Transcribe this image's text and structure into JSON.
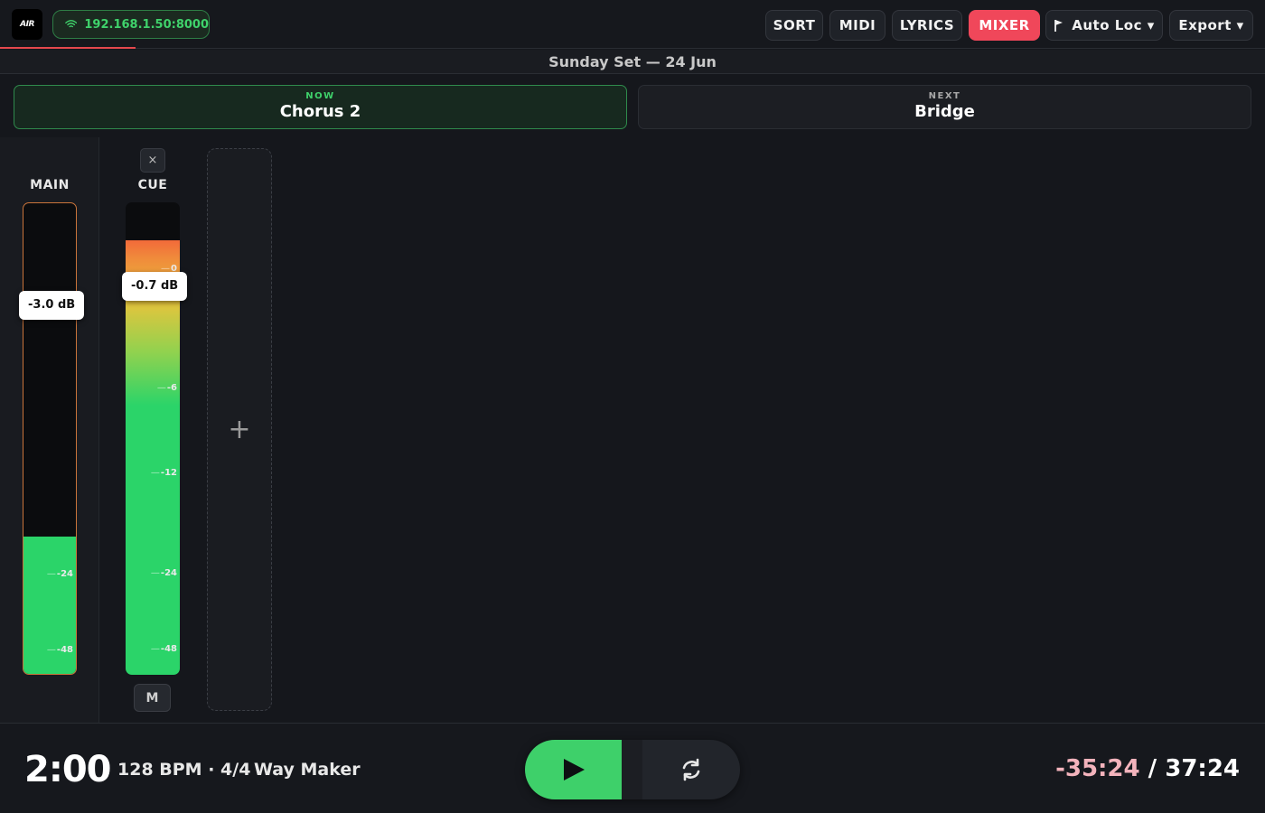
{
  "app": {
    "logo_text": "AIR",
    "connection_address": "192.168.1.50:8000",
    "connection_icon": "wifi-icon"
  },
  "toolbar": {
    "sort_label": "SORT",
    "midi_label": "MIDI",
    "lyrics_label": "LYRICS",
    "mixer_label": "MIXER",
    "active_tab": "MIXER",
    "autoloc_label": "Auto Loc ▾",
    "autoloc_icon": "flag-icon",
    "export_label": "Export ▾",
    "accent_color": "#f0475a"
  },
  "setlist": {
    "title": "Sunday Set — 24 Jun"
  },
  "sections": {
    "now_caption": "NOW",
    "now_name": "Chorus 2",
    "next_caption": "NEXT",
    "next_name": "Bridge"
  },
  "mixer": {
    "main": {
      "label": "MAIN",
      "level_db": "-3.0 dB",
      "meter_fraction": 0.29,
      "ticks": [
        "-24",
        "-48"
      ]
    },
    "cue": {
      "label": "CUE",
      "level_db": "-0.7 dB",
      "meter_fraction": 0.92,
      "ticks": [
        "0",
        "-6",
        "-12",
        "-24",
        "-48"
      ],
      "close_label": "×",
      "mute_label": "M"
    },
    "add_channel_label": "+"
  },
  "transport": {
    "elapsed": "2:00",
    "tempo": "128 BPM · 4/4",
    "song": "Way Maker",
    "remaining": "-35:24",
    "separator": " / ",
    "total": "37:24",
    "play_icon": "play-icon",
    "loop_icon": "loop-icon",
    "play_color": "#3ed06a"
  }
}
